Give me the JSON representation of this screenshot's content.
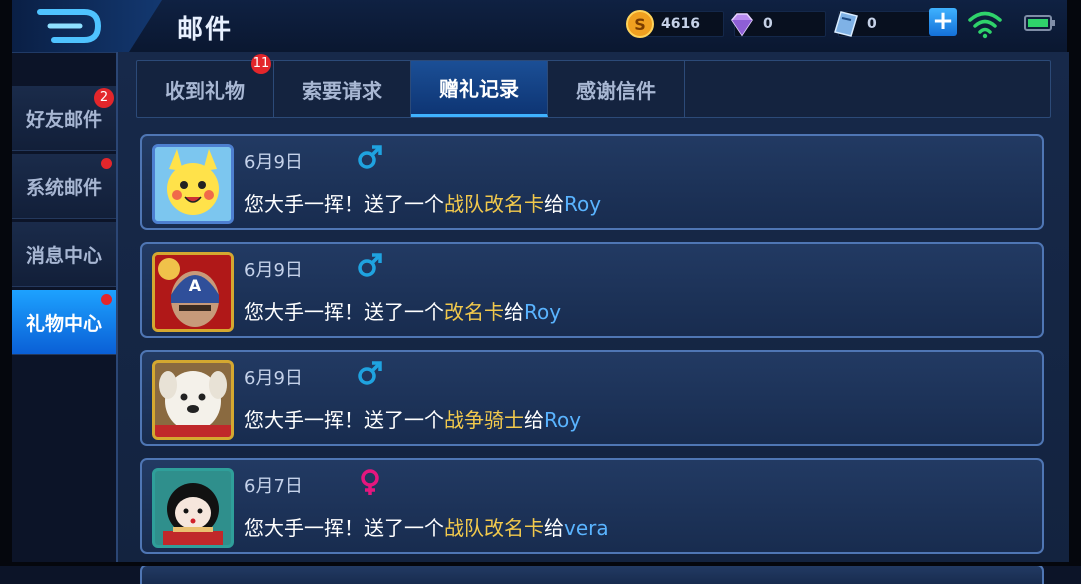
{
  "header": {
    "title": "邮件",
    "gold": "4616",
    "diamond": "0",
    "voucher": "0"
  },
  "sidebar": {
    "items": [
      {
        "label": "好友邮件",
        "badge": "2"
      },
      {
        "label": "系统邮件"
      },
      {
        "label": "消息中心"
      },
      {
        "label": "礼物中心"
      }
    ]
  },
  "tabs": [
    {
      "label": "收到礼物",
      "badge": "11"
    },
    {
      "label": "索要请求"
    },
    {
      "label": "赠礼记录"
    },
    {
      "label": "感谢信件"
    }
  ],
  "records": [
    {
      "date": "6月9日",
      "gender": "male",
      "prefix": "您大手一挥！送了一个",
      "gift": "战队改名卡",
      "to": "给",
      "recipient": "Roy"
    },
    {
      "date": "6月9日",
      "gender": "male",
      "prefix": "您大手一挥！送了一个",
      "gift": "改名卡",
      "to": "给",
      "recipient": "Roy"
    },
    {
      "date": "6月9日",
      "gender": "male",
      "prefix": "您大手一挥！送了一个",
      "gift": "战争骑士",
      "to": "给",
      "recipient": "Roy"
    },
    {
      "date": "6月7日",
      "gender": "female",
      "prefix": "您大手一挥！送了一个",
      "gift": "战队改名卡",
      "to": "给",
      "recipient": "vera"
    }
  ],
  "colors": {
    "accent": "#1da2ff",
    "gift_highlight": "#f2c94c",
    "recipient": "#5ab4ff",
    "male": "#1fa3e0",
    "female": "#e5167e",
    "badge": "#e3262b"
  }
}
